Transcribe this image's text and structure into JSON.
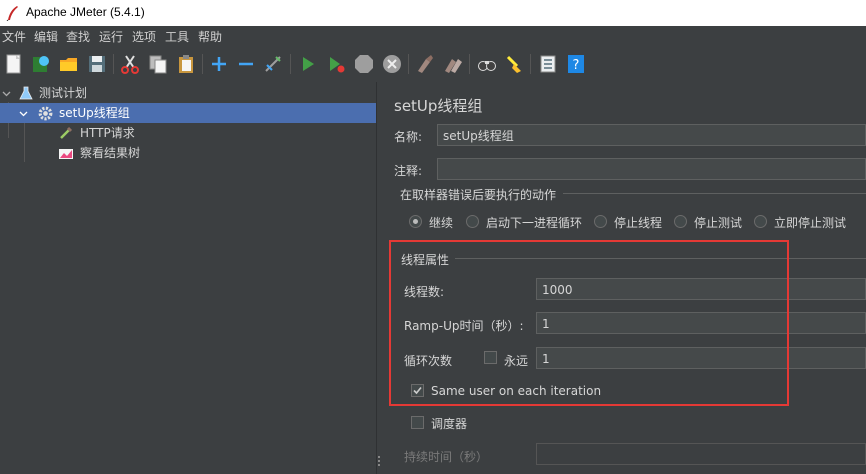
{
  "window": {
    "title": "Apache JMeter (5.4.1)"
  },
  "menu": [
    "文件",
    "编辑",
    "查找",
    "运行",
    "选项",
    "工具",
    "帮助"
  ],
  "toolbar_icons": [
    "new-icon",
    "templates-icon",
    "open-icon",
    "save-icon",
    "cut-icon",
    "copy-icon",
    "paste-icon",
    "expand-icon",
    "collapse-icon",
    "toggle-icon",
    "start-icon",
    "start-no-pause-icon",
    "stop-icon",
    "shutdown-icon",
    "clear-icon",
    "clear-all-icon",
    "search-icon",
    "reset-search-icon",
    "function-helper-icon",
    "help-icon"
  ],
  "tree": {
    "items": [
      {
        "label": "测试计划",
        "icon": "test-plan-icon"
      },
      {
        "label": "setUp线程组",
        "icon": "gear-icon"
      },
      {
        "label": "HTTP请求",
        "icon": "pipette-icon"
      },
      {
        "label": "察看结果树",
        "icon": "chart-icon"
      }
    ]
  },
  "panel": {
    "title": "setUp线程组",
    "name_label": "名称:",
    "name_value": "setUp线程组",
    "comment_label": "注释:",
    "comment_value": "",
    "error_action_title": "在取样器错误后要执行的动作",
    "error_actions": [
      "继续",
      "启动下一进程循环",
      "停止线程",
      "停止测试",
      "立即停止测试"
    ],
    "selected_error_action": "继续",
    "thread_props_title": "线程属性",
    "threads_label": "线程数:",
    "threads_value": "1000",
    "rampup_label": "Ramp-Up时间（秒）:",
    "rampup_value": "1",
    "loop_label": "循环次数",
    "forever_label": "永远",
    "loop_value": "1",
    "same_user_label": "Same user on each iteration",
    "scheduler_label": "调度器",
    "duration_label": "持续时间（秒）",
    "duration_value": ""
  }
}
